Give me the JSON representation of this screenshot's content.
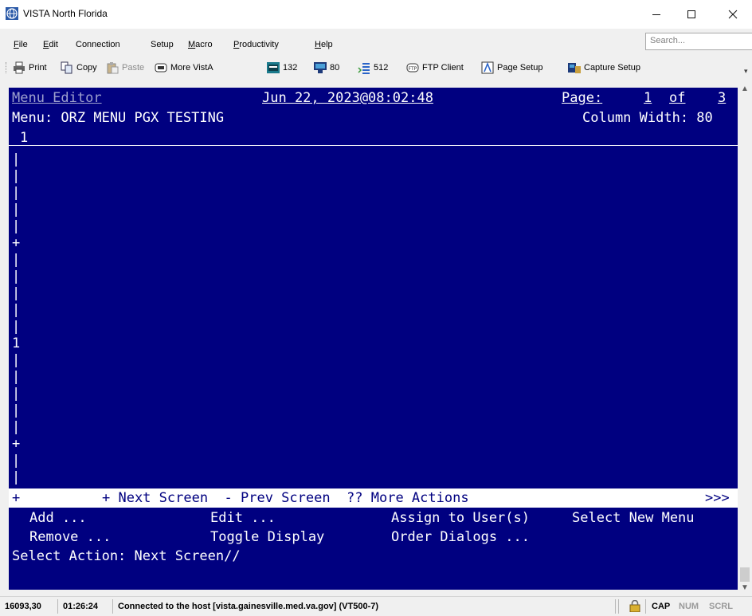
{
  "window": {
    "title": "VISTA North Florida",
    "minimize_glyph": "—",
    "maximize_glyph": "☐",
    "close_glyph": "✕"
  },
  "menubar": {
    "items": [
      {
        "label": "File",
        "accel": "F",
        "rest": "ile"
      },
      {
        "label": "Edit",
        "accel": "E",
        "rest": "dit"
      },
      {
        "label": "Connection",
        "accel": "",
        "rest": ""
      },
      {
        "label": "Setup",
        "accel": "",
        "rest": ""
      },
      {
        "label": "Macro",
        "accel": "M",
        "rest": "acro"
      },
      {
        "label": "Productivity",
        "accel": "P",
        "rest": "roductivity"
      },
      {
        "label": "Help",
        "accel": "H",
        "rest": "elp"
      }
    ],
    "search_placeholder": "Search..."
  },
  "toolbar": {
    "print": "Print",
    "copy": "Copy",
    "paste": "Paste",
    "more_vista": "More VistA",
    "cols_132": "132",
    "cols_80": "80",
    "buffer_512": "512",
    "ftp_client": "FTP Client",
    "page_setup": "Page Setup",
    "capture_setup": "Capture Setup"
  },
  "terminal": {
    "header_left": "Menu Editor",
    "header_date": "Jun 22, 2023@08:02:48",
    "header_page_label": "Page:",
    "header_page_num": "1",
    "header_page_of": "of",
    "header_page_total": "3",
    "menu_line": "Menu: ORZ MENU PGX TESTING",
    "column_width": "Column Width: 80",
    "col_marker": "1",
    "gutter_rows": [
      "|",
      "|",
      "|",
      "|",
      "|",
      "+",
      "|",
      "|",
      "|",
      "|",
      "|",
      "1",
      "|",
      "|",
      "|",
      "|",
      "|",
      "+",
      "|",
      "|"
    ],
    "action_bar_left": "+",
    "action_bar_text": "+ Next Screen  - Prev Screen  ?? More Actions",
    "action_bar_right": ">>>",
    "actions_row1": [
      "Add ...",
      "Edit ...",
      "Assign to User(s)",
      "Select New Menu"
    ],
    "actions_row2": [
      "Remove ...",
      "Toggle Display",
      "Order Dialogs ..."
    ],
    "prompt": "Select Action: Next Screen//"
  },
  "statusbar": {
    "cursor_pos": "16093,30",
    "time": "01:26:24",
    "connection": "Connected to the host [vista.gainesville.med.va.gov] (VT500-7)",
    "cap": "CAP",
    "num": "NUM",
    "scrl": "SCRL"
  },
  "colors": {
    "terminal_bg": "#000080",
    "terminal_fg": "#ffffff",
    "action_bar_bg": "#ffffff"
  }
}
